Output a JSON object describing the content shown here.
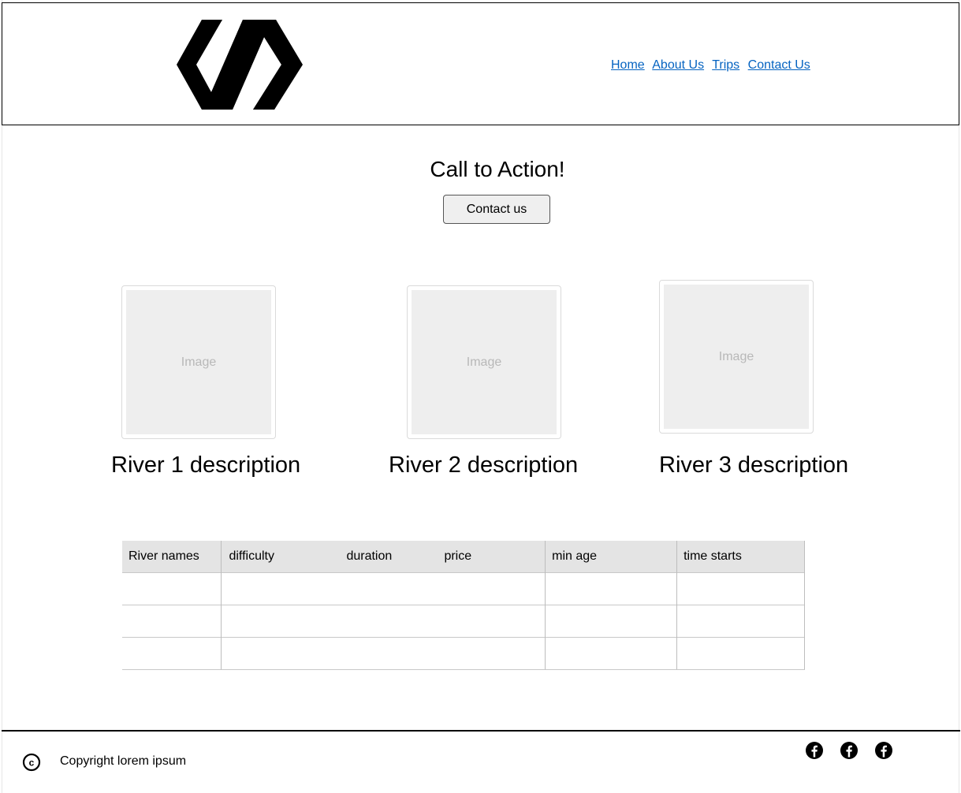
{
  "header": {
    "logo_icon": "code-slash-logo-icon",
    "nav": [
      "Home",
      "About Us",
      "Trips",
      "Contact Us"
    ]
  },
  "hero": {
    "title": "Call to Action!",
    "button_label": "Contact us"
  },
  "rivers": [
    {
      "image_placeholder": "Image",
      "description": "River 1 description"
    },
    {
      "image_placeholder": "Image",
      "description": "River 2 description"
    },
    {
      "image_placeholder": "Image",
      "description": "River 3 description"
    }
  ],
  "table": {
    "headers": [
      "River names",
      "difficulty",
      "duration",
      "price",
      "min age",
      "time starts"
    ],
    "rows": [
      [
        "",
        "",
        "",
        ""
      ],
      [
        "",
        "",
        "",
        ""
      ],
      [
        "",
        "",
        "",
        ""
      ]
    ]
  },
  "footer": {
    "copyright_icon": "copyright-icon",
    "copyright_text": "Copyright lorem ipsum",
    "social_icons": [
      "facebook-icon",
      "facebook-icon",
      "facebook-icon"
    ]
  }
}
